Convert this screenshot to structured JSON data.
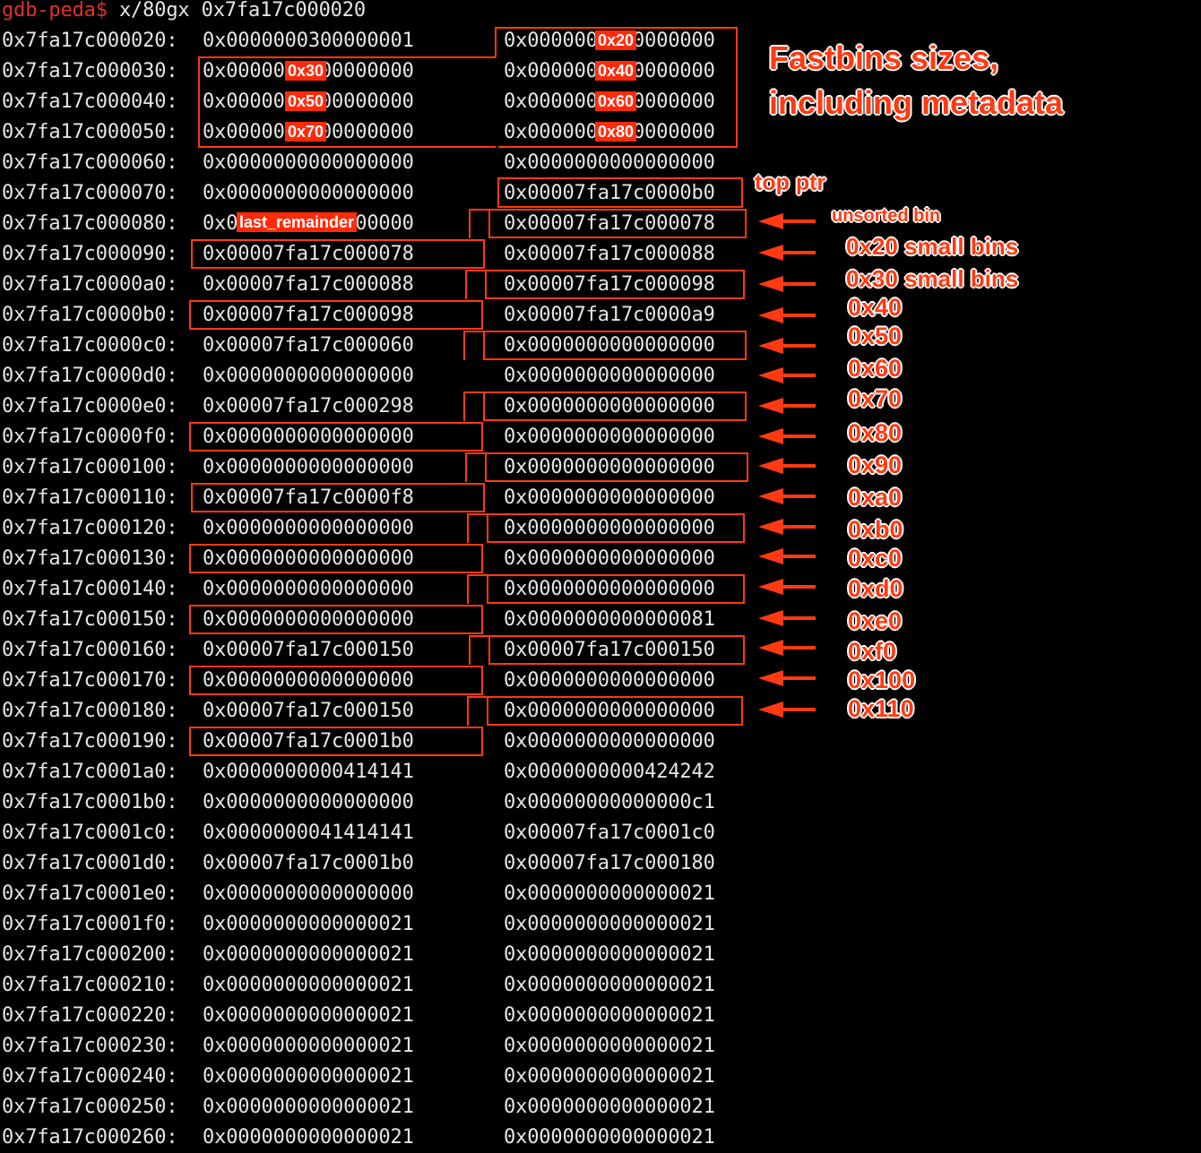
{
  "prompt": "gdb-peda$",
  "command": " x/80gx 0x7fa17c000020",
  "rows": [
    [
      "0x7fa17c000020:",
      "0x0000000300000001",
      "0x0000000000000000"
    ],
    [
      "0x7fa17c000030:",
      "0x0000000000000000",
      "0x0000000000000000"
    ],
    [
      "0x7fa17c000040:",
      "0x0000000000000000",
      "0x0000000000000000"
    ],
    [
      "0x7fa17c000050:",
      "0x0000000000000000",
      "0x0000000000000000"
    ],
    [
      "0x7fa17c000060:",
      "0x0000000000000000",
      "0x0000000000000000"
    ],
    [
      "0x7fa17c000070:",
      "0x0000000000000000",
      "0x00007fa17c0000b0"
    ],
    [
      "0x7fa17c000080:",
      "0x0000000000000000",
      "0x00007fa17c000078"
    ],
    [
      "0x7fa17c000090:",
      "0x00007fa17c000078",
      "0x00007fa17c000088"
    ],
    [
      "0x7fa17c0000a0:",
      "0x00007fa17c000088",
      "0x00007fa17c000098"
    ],
    [
      "0x7fa17c0000b0:",
      "0x00007fa17c000098",
      "0x00007fa17c0000a9"
    ],
    [
      "0x7fa17c0000c0:",
      "0x00007fa17c000060",
      "0x0000000000000000"
    ],
    [
      "0x7fa17c0000d0:",
      "0x0000000000000000",
      "0x0000000000000000"
    ],
    [
      "0x7fa17c0000e0:",
      "0x00007fa17c000298",
      "0x0000000000000000"
    ],
    [
      "0x7fa17c0000f0:",
      "0x0000000000000000",
      "0x0000000000000000"
    ],
    [
      "0x7fa17c000100:",
      "0x0000000000000000",
      "0x0000000000000000"
    ],
    [
      "0x7fa17c000110:",
      "0x00007fa17c0000f8",
      "0x0000000000000000"
    ],
    [
      "0x7fa17c000120:",
      "0x0000000000000000",
      "0x0000000000000000"
    ],
    [
      "0x7fa17c000130:",
      "0x0000000000000000",
      "0x0000000000000000"
    ],
    [
      "0x7fa17c000140:",
      "0x0000000000000000",
      "0x0000000000000000"
    ],
    [
      "0x7fa17c000150:",
      "0x0000000000000000",
      "0x0000000000000081"
    ],
    [
      "0x7fa17c000160:",
      "0x00007fa17c000150",
      "0x00007fa17c000150"
    ],
    [
      "0x7fa17c000170:",
      "0x0000000000000000",
      "0x0000000000000000"
    ],
    [
      "0x7fa17c000180:",
      "0x00007fa17c000150",
      "0x0000000000000000"
    ],
    [
      "0x7fa17c000190:",
      "0x00007fa17c0001b0",
      "0x0000000000000000"
    ],
    [
      "0x7fa17c0001a0:",
      "0x0000000000414141",
      "0x0000000000424242"
    ],
    [
      "0x7fa17c0001b0:",
      "0x0000000000000000",
      "0x00000000000000c1"
    ],
    [
      "0x7fa17c0001c0:",
      "0x0000000041414141",
      "0x00007fa17c0001c0"
    ],
    [
      "0x7fa17c0001d0:",
      "0x00007fa17c0001b0",
      "0x00007fa17c000180"
    ],
    [
      "0x7fa17c0001e0:",
      "0x0000000000000000",
      "0x0000000000000021"
    ],
    [
      "0x7fa17c0001f0:",
      "0x0000000000000021",
      "0x0000000000000021"
    ],
    [
      "0x7fa17c000200:",
      "0x0000000000000021",
      "0x0000000000000021"
    ],
    [
      "0x7fa17c000210:",
      "0x0000000000000021",
      "0x0000000000000021"
    ],
    [
      "0x7fa17c000220:",
      "0x0000000000000021",
      "0x0000000000000021"
    ],
    [
      "0x7fa17c000230:",
      "0x0000000000000021",
      "0x0000000000000021"
    ],
    [
      "0x7fa17c000240:",
      "0x0000000000000021",
      "0x0000000000000021"
    ],
    [
      "0x7fa17c000250:",
      "0x0000000000000021",
      "0x0000000000000021"
    ],
    [
      "0x7fa17c000260:",
      "0x0000000000000021",
      "0x0000000000000021"
    ]
  ],
  "annotations": {
    "fastbins_title": "Fastbins sizes,",
    "fastbins_subtitle": "including metadata",
    "top_ptr": "top ptr",
    "unsorted_bin": "unsorted bin",
    "last_remainder": "last_remainder",
    "fastbin_tags": [
      "0x20",
      "0x30",
      "0x40",
      "0x50",
      "0x60",
      "0x70",
      "0x80"
    ],
    "smallbin_labels": [
      "0x20 small bins",
      "0x30 small bins",
      "0x40",
      "0x50",
      "0x60",
      "0x70",
      "0x80",
      "0x90",
      "0xa0",
      "0xb0",
      "0xc0",
      "0xd0",
      "0xe0",
      "0xf0",
      "0x100",
      "0x110"
    ]
  },
  "colors": {
    "annotation": "#ff3a12",
    "prompt": "#e0322a",
    "text": "#e6e6e6",
    "background": "#000000"
  }
}
